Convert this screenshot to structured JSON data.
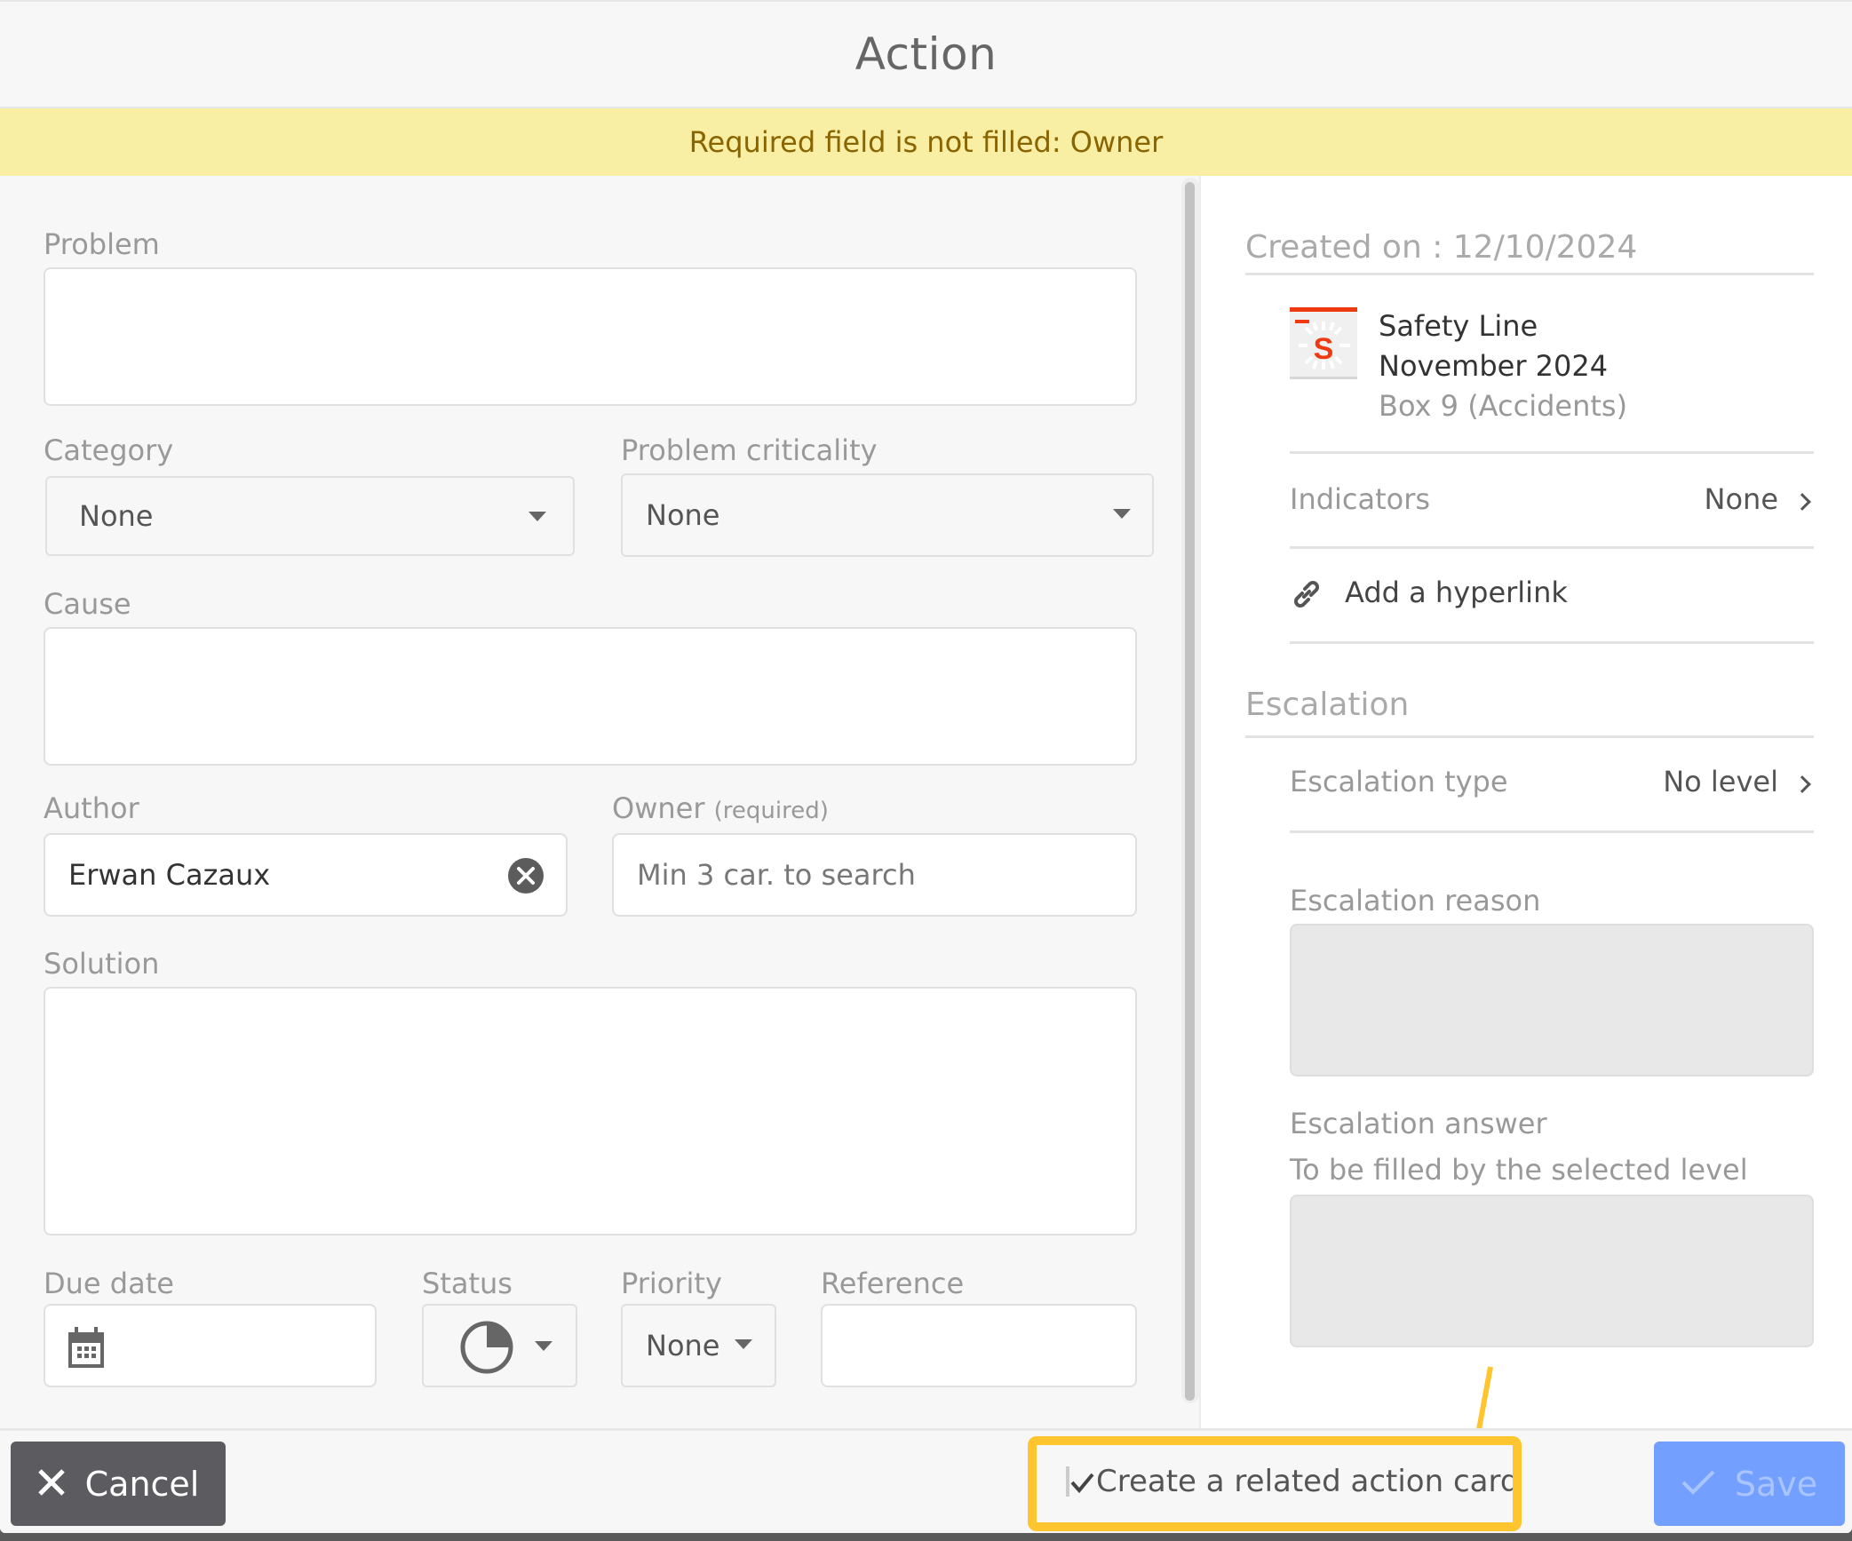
{
  "dialog": {
    "title": "Action",
    "warning": "Required field is not filled: Owner"
  },
  "form": {
    "problem": {
      "label": "Problem",
      "value": ""
    },
    "category": {
      "label": "Category",
      "selected": "None"
    },
    "criticality": {
      "label": "Problem criticality",
      "selected": "None"
    },
    "cause": {
      "label": "Cause",
      "value": ""
    },
    "author": {
      "label": "Author",
      "value": "Erwan Cazaux",
      "clear_icon": "clear-circle-icon"
    },
    "owner": {
      "label": "Owner",
      "required_note": "(required)",
      "placeholder": "Min 3 car. to search",
      "value": ""
    },
    "solution": {
      "label": "Solution",
      "value": ""
    },
    "due_date": {
      "label": "Due date",
      "value": "",
      "icon": "calendar-icon"
    },
    "status": {
      "label": "Status",
      "icon": "pie-quarter-icon",
      "progress_fraction": 0.25
    },
    "priority": {
      "label": "Priority",
      "selected": "None"
    },
    "reference": {
      "label": "Reference",
      "value": ""
    }
  },
  "side": {
    "created_on": "Created on : 12/10/2024",
    "source": {
      "icon": "safety-line-logo-icon",
      "logo_letter": "S",
      "title": "Safety Line",
      "period": "November 2024",
      "box": "Box 9 (Accidents)"
    },
    "indicators": {
      "label": "Indicators",
      "value": "None"
    },
    "hyperlink": {
      "label": "Add a hyperlink",
      "icon": "link-icon"
    },
    "escalation": {
      "heading": "Escalation",
      "type_label": "Escalation type",
      "type_value": "No level",
      "reason_label": "Escalation reason",
      "reason_value": "",
      "answer_label": "Escalation answer",
      "answer_hint": "To be filled by the selected level",
      "answer_value": ""
    }
  },
  "footer": {
    "cancel_label": "Cancel",
    "save_label": "Save",
    "related_card_label": "Create a related action card",
    "related_card_checked": true
  },
  "colors": {
    "warning_bg": "#f9efa4",
    "warning_text": "#8a6400",
    "cancel_bg": "#5c5b60",
    "save_bg": "#73a0ff",
    "highlight": "#ffc52f",
    "brand_red": "#ee3a10"
  }
}
